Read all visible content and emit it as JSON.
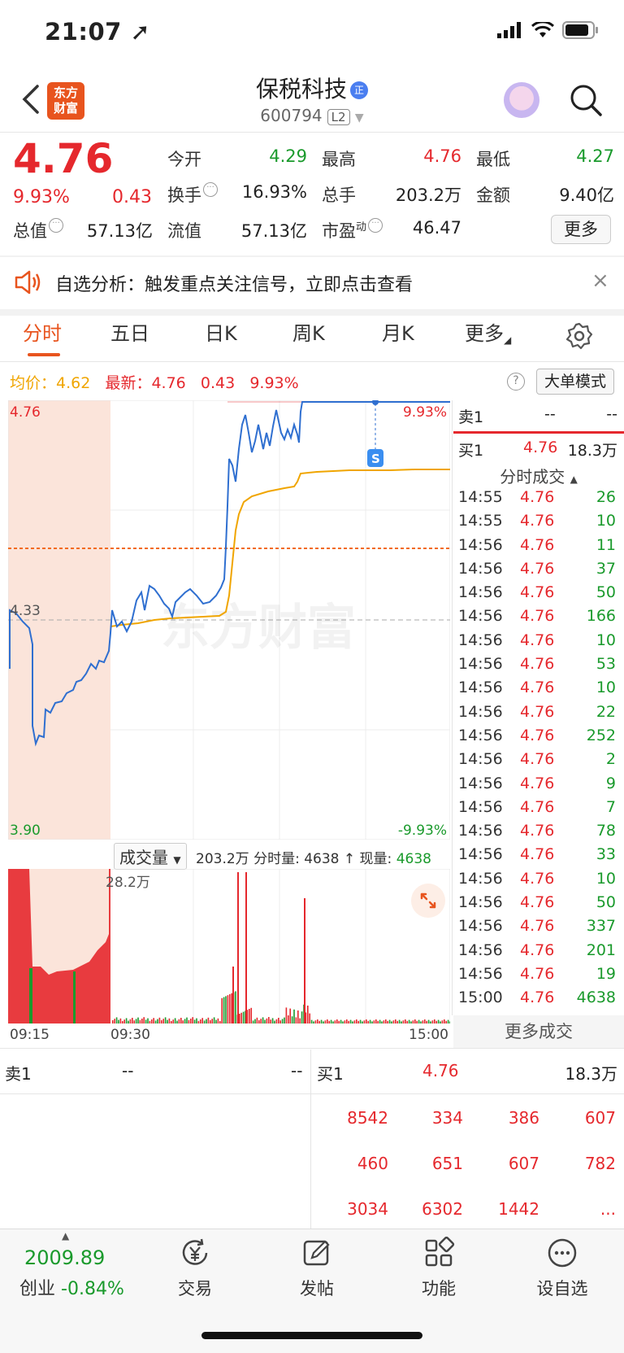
{
  "status": {
    "time": "21:07"
  },
  "header": {
    "stock_name": "保税科技",
    "verified": "正",
    "stock_code": "600794",
    "level_badge": "L2",
    "logo_line1": "东方",
    "logo_line2": "财富"
  },
  "quote": {
    "price": "4.76",
    "change_pct": "9.93%",
    "change": "0.43",
    "open_label": "今开",
    "open": "4.29",
    "high_label": "最高",
    "high": "4.76",
    "low_label": "最低",
    "low": "4.27",
    "turnover_label": "换手",
    "turnover": "16.93%",
    "volume_label": "总手",
    "volume": "203.2万",
    "amount_label": "金额",
    "amount": "9.40亿",
    "mktcap_label": "总值",
    "mktcap": "57.13亿",
    "float_label": "流值",
    "float_cap": "57.13亿",
    "pe_label": "市盈",
    "pe_sup": "动",
    "pe": "46.47",
    "more_label": "更多"
  },
  "alert": {
    "text": "自选分析：触发重点关注信号，立即点击查看",
    "close": "×"
  },
  "tabs": [
    "分时",
    "五日",
    "日K",
    "周K",
    "月K",
    "更多"
  ],
  "chart_header": {
    "avg_label": "均价：",
    "avg": "4.62",
    "latest_label": "最新：",
    "latest": "4.76",
    "latest_chg": "0.43",
    "latest_pct": "9.93%",
    "help": "?",
    "mode_btn": "大单模式"
  },
  "chart_labels": {
    "top_price": "4.76",
    "mid_price": "4.33",
    "bottom_price": "3.90",
    "top_pct": "9.93%",
    "bottom_pct": "-9.93%",
    "signal": "S",
    "watermark": "东方财富",
    "max_vol": "28.2万"
  },
  "volume_header": {
    "select": "成交量",
    "total": "203.2万",
    "minute_label": "分时量: 4638",
    "arrow": "↑",
    "now_label": "现量:",
    "now": "4638"
  },
  "time_axis": [
    "09:15",
    "09:30",
    "15:00"
  ],
  "orderbook": {
    "sell1_label": "卖1",
    "sell1_price": "--",
    "sell1_vol": "--",
    "buy1_label": "买1",
    "buy1_price": "4.76",
    "buy1_vol": "18.3万"
  },
  "trades_title": "分时成交",
  "trades": [
    [
      "14:55",
      "4.76",
      "26"
    ],
    [
      "14:55",
      "4.76",
      "10"
    ],
    [
      "14:56",
      "4.76",
      "11"
    ],
    [
      "14:56",
      "4.76",
      "37"
    ],
    [
      "14:56",
      "4.76",
      "50"
    ],
    [
      "14:56",
      "4.76",
      "166"
    ],
    [
      "14:56",
      "4.76",
      "10"
    ],
    [
      "14:56",
      "4.76",
      "53"
    ],
    [
      "14:56",
      "4.76",
      "10"
    ],
    [
      "14:56",
      "4.76",
      "22"
    ],
    [
      "14:56",
      "4.76",
      "252"
    ],
    [
      "14:56",
      "4.76",
      "2"
    ],
    [
      "14:56",
      "4.76",
      "9"
    ],
    [
      "14:56",
      "4.76",
      "7"
    ],
    [
      "14:56",
      "4.76",
      "78"
    ],
    [
      "14:56",
      "4.76",
      "33"
    ],
    [
      "14:56",
      "4.76",
      "10"
    ],
    [
      "14:56",
      "4.76",
      "50"
    ],
    [
      "14:56",
      "4.76",
      "337"
    ],
    [
      "14:56",
      "4.76",
      "201"
    ],
    [
      "14:56",
      "4.76",
      "19"
    ],
    [
      "15:00",
      "4.76",
      "4638"
    ]
  ],
  "more_trades": "更多成交",
  "book_bottom": {
    "sell1_label": "卖1",
    "sell1_price": "--",
    "sell1_vol": "--",
    "buy1_label": "买1",
    "buy1_price": "4.76",
    "buy1_vol": "18.3万",
    "queue": [
      [
        "8542",
        "334",
        "386",
        "607"
      ],
      [
        "460",
        "651",
        "607",
        "782"
      ],
      [
        "3034",
        "6302",
        "1442",
        "..."
      ]
    ]
  },
  "bottom_nav": {
    "index_value": "2009.89",
    "index_name": "创业",
    "index_pct": "-0.84%",
    "items": [
      "交易",
      "发帖",
      "功能",
      "设自选"
    ]
  },
  "colors": {
    "up": "#e5282d",
    "down": "#1a9a2c",
    "avg": "#f0a500",
    "line": "#2f6fd0",
    "brand": "#e8541e"
  }
}
